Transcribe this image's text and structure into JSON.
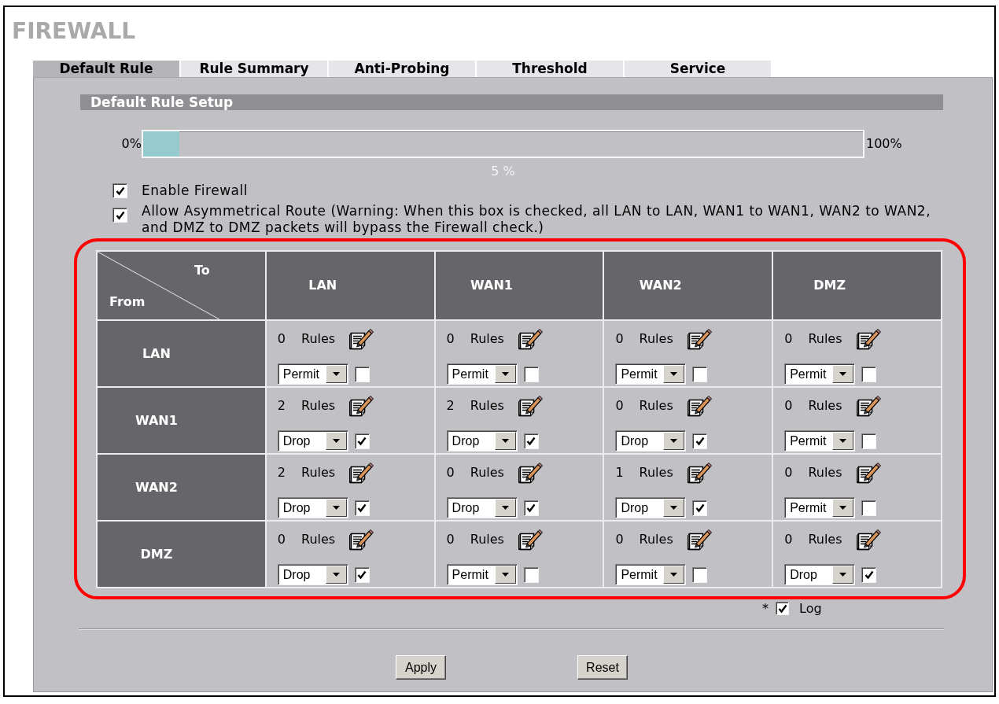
{
  "page_title": "FIREWALL",
  "tabs": [
    {
      "label": "Default Rule",
      "selected": true
    },
    {
      "label": "Rule Summary",
      "selected": false
    },
    {
      "label": "Anti-Probing",
      "selected": false
    },
    {
      "label": "Threshold",
      "selected": false
    },
    {
      "label": "Service",
      "selected": false
    }
  ],
  "section": {
    "title": "Default Rule Setup"
  },
  "usage": {
    "min_label": "0%",
    "level": 0.05,
    "max_label": "100%",
    "reading": "5 %"
  },
  "options": [
    {
      "label": "Enable Firewall",
      "checked": true
    },
    {
      "label": "Allow Asymmetrical Route (Warning: When this box is checked, all LAN to LAN, WAN1 to WAN1, WAN2 to WAN2, and DMZ to DMZ packets will bypass the Firewall check.)",
      "checked": true
    }
  ],
  "matrix": {
    "to_label": "To",
    "from_label": "From",
    "columns": [
      "LAN",
      "WAN1",
      "WAN2",
      "DMZ"
    ],
    "rows": [
      {
        "label": "LAN",
        "cells": [
          {
            "count": "0",
            "unit": "Rules",
            "action": "Permit",
            "log": false
          },
          {
            "count": "0",
            "unit": "Rules",
            "action": "Permit",
            "log": false
          },
          {
            "count": "0",
            "unit": "Rules",
            "action": "Permit",
            "log": false
          },
          {
            "count": "0",
            "unit": "Rules",
            "action": "Permit",
            "log": false
          }
        ]
      },
      {
        "label": "WAN1",
        "cells": [
          {
            "count": "2",
            "unit": "Rules",
            "action": "Drop",
            "log": true
          },
          {
            "count": "2",
            "unit": "Rules",
            "action": "Drop",
            "log": true
          },
          {
            "count": "0",
            "unit": "Rules",
            "action": "Drop",
            "log": true
          },
          {
            "count": "0",
            "unit": "Rules",
            "action": "Permit",
            "log": false
          }
        ]
      },
      {
        "label": "WAN2",
        "cells": [
          {
            "count": "2",
            "unit": "Rules",
            "action": "Drop",
            "log": true
          },
          {
            "count": "0",
            "unit": "Rules",
            "action": "Drop",
            "log": true
          },
          {
            "count": "1",
            "unit": "Rules",
            "action": "Drop",
            "log": true
          },
          {
            "count": "0",
            "unit": "Rules",
            "action": "Permit",
            "log": false
          }
        ]
      },
      {
        "label": "DMZ",
        "cells": [
          {
            "count": "0",
            "unit": "Rules",
            "action": "Drop",
            "log": true
          },
          {
            "count": "0",
            "unit": "Rules",
            "action": "Permit",
            "log": false
          },
          {
            "count": "0",
            "unit": "Rules",
            "action": "Permit",
            "log": false
          },
          {
            "count": "0",
            "unit": "Rules",
            "action": "Drop",
            "log": true
          }
        ]
      }
    ]
  },
  "log_note": {
    "marker": "*",
    "checked": true,
    "label": "Log"
  },
  "buttons": [
    "Apply",
    "Reset"
  ]
}
